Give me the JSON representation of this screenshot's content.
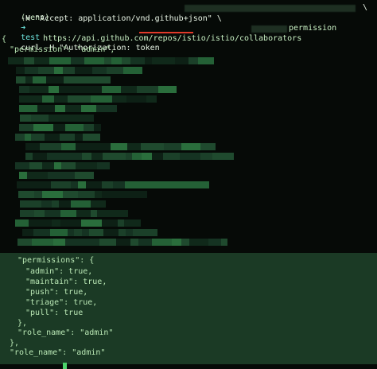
{
  "terminal": {
    "prompt": {
      "venv": "(venv)",
      "arrow": "➜",
      "cwd": "test"
    },
    "command": {
      "line1": "curl -H \"Authorization: token",
      "line1_tail": "\\",
      "line2": "-H \"Accept: application/vnd.github+json\" \\",
      "line3_prefix": "https://api.github.com/repos/",
      "line3_highlight": "istio/istio",
      "line3_mid": "/collaborators",
      "line3_suffix": "permission"
    },
    "output": {
      "open_brace": "{",
      "permission_line": "\"permission\": \"admin\",",
      "permissions_open": "\"permissions\": {",
      "admin": "\"admin\": true,",
      "maintain": "\"maintain\": true,",
      "push": "\"push\": true,",
      "triage": "\"triage\": true,",
      "pull": "\"pull\": true",
      "permissions_close": "},",
      "role_name_inner": "\"role_name\": \"admin\"",
      "inner_close": "},",
      "role_name_outer": "\"role_name\": \"admin\""
    }
  },
  "colors": {
    "background": "#060a07",
    "highlight_background": "#1b3a25",
    "annotation_underline": "#e23a2a",
    "cursor": "#4bd36a"
  }
}
